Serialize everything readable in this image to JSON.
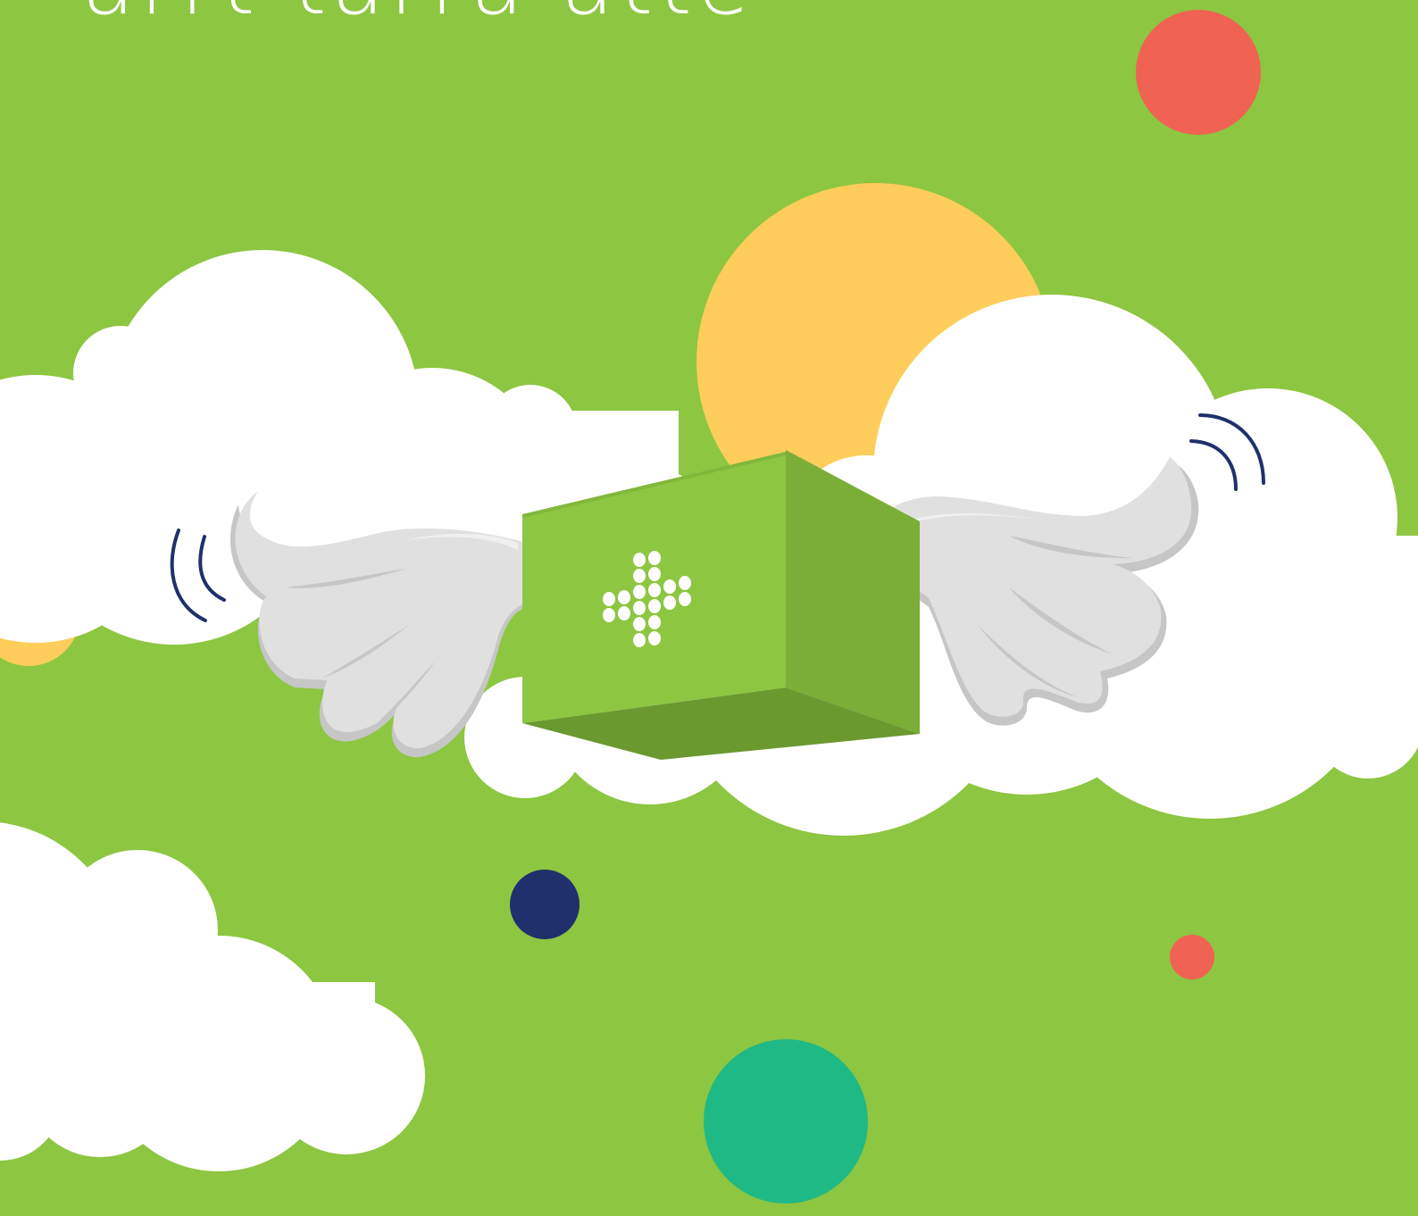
{
  "headline": "arrt tarra atte",
  "colors": {
    "background": "#8dc641",
    "cloud": "#ffffff",
    "sun": "#fecd5b",
    "red_dot": "#f06252",
    "navy_dot": "#1f306c",
    "teal_dot": "#1fb985",
    "box_front": "#8dc641",
    "box_side": "#7aae37",
    "box_bottom": "#6a9930",
    "wing": "#e0e0e0",
    "wing_shadow": "#c6c6c6",
    "motion_lines": "#1f306c"
  },
  "icons": {
    "box_logo": "hash-dots-logo-icon",
    "motion": "motion-lines-icon"
  }
}
